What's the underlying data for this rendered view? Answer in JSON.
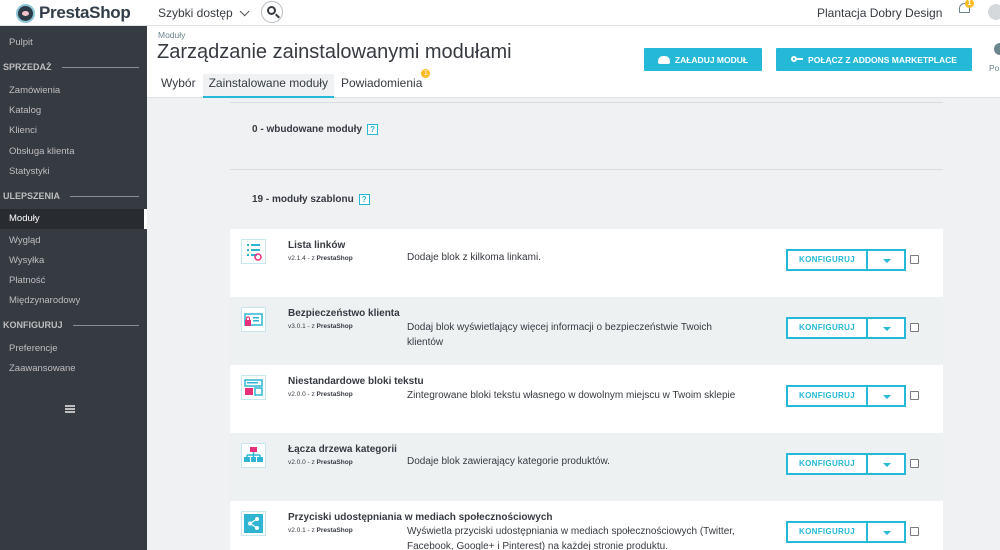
{
  "topbar": {
    "logo_text": "PrestaShop",
    "quick_access": "Szybki dostęp",
    "shop_name": "Plantacja Dobry Design",
    "notification_count": "1"
  },
  "sidebar": {
    "items": [
      {
        "label": "Pulpit"
      },
      {
        "label": "SPRZEDAŻ"
      },
      {
        "label": "Zamówienia"
      },
      {
        "label": "Katalog"
      },
      {
        "label": "Klienci"
      },
      {
        "label": "Obsługa klienta"
      },
      {
        "label": "Statystyki"
      },
      {
        "label": "ULEPSZENIA"
      },
      {
        "label": "Moduły"
      },
      {
        "label": "Wygląd"
      },
      {
        "label": "Wysyłka"
      },
      {
        "label": "Płatność"
      },
      {
        "label": "Międzynarodowy"
      },
      {
        "label": "KONFIGURUJ"
      },
      {
        "label": "Preferencje"
      },
      {
        "label": "Zaawansowane"
      }
    ]
  },
  "header": {
    "breadcrumb": "Moduły",
    "title": "Zarządzanie zainstalowanymi modułami",
    "upload_button": "ZAŁADUJ MODUŁ",
    "connect_button": "POŁĄCZ Z ADDONS MARKETPLACE",
    "help_label": "Por",
    "tabs": [
      {
        "label": "Wybór"
      },
      {
        "label": "Zainstalowane moduły"
      },
      {
        "label": "Powiadomienia"
      }
    ],
    "notifications_badge": "1"
  },
  "groups": [
    {
      "title": "0 - wbudowane moduły",
      "help": "?"
    },
    {
      "title": "19 - moduły szablonu",
      "help": "?"
    }
  ],
  "modules": [
    {
      "name": "Lista linków",
      "version": "v2.1.4 - z",
      "author": "PrestaShop",
      "description": "Dodaje blok z kilkoma linkami.",
      "configure": "KONFIGURUJ"
    },
    {
      "name": "Bezpieczeństwo klienta",
      "version": "v3.0.1 - z",
      "author": "PrestaShop",
      "description": "Dodaj blok wyświetlający więcej informacji o bezpieczeństwie Twoich klientów",
      "configure": "KONFIGURUJ"
    },
    {
      "name": "Niestandardowe bloki tekstu",
      "version": "v2.0.0 - z",
      "author": "PrestaShop",
      "description": "Zintegrowane bloki tekstu własnego w dowolnym miejscu w Twoim sklepie",
      "configure": "KONFIGURUJ"
    },
    {
      "name": "Łącza drzewa kategorii",
      "version": "v2.0.0 - z",
      "author": "PrestaShop",
      "description": "Dodaje blok zawierający kategorie produktów.",
      "configure": "KONFIGURUJ"
    },
    {
      "name": "Przyciski udostępniania w mediach społecznościowych",
      "version": "v2.0.1 - z",
      "author": "PrestaShop",
      "description": "Wyświetla przyciski udostępniania w mediach społecznościowych (Twitter, Facebook, Google+ i Pinterest) na każdej stronie produktu.",
      "configure": "KONFIGURUJ"
    }
  ],
  "colors": {
    "accent": "#25b9d7",
    "sidebar_bg": "#363a41",
    "warning_badge": "#fbbb22"
  }
}
